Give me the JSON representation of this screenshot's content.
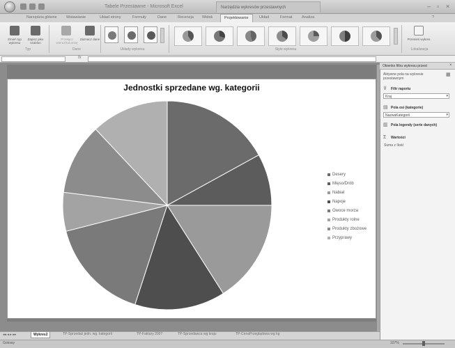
{
  "window": {
    "title": "Tabele Przestawne - Microsoft Excel",
    "context_tab_group": "Narzędzia wykresów przestawnych"
  },
  "ribbon": {
    "tabs": [
      {
        "label": "Narzędzia główne"
      },
      {
        "label": "Wstawianie"
      },
      {
        "label": "Układ strony"
      },
      {
        "label": "Formuły"
      },
      {
        "label": "Dane"
      },
      {
        "label": "Recenzja"
      },
      {
        "label": "Widok"
      },
      {
        "label": "Projektowanie",
        "active": true
      },
      {
        "label": "Układ"
      },
      {
        "label": "Format"
      },
      {
        "label": "Analiza"
      }
    ],
    "groups": {
      "type": {
        "label": "Typ",
        "buttons": [
          "Zmień typ wykresu",
          "Zapisz jako szablon"
        ]
      },
      "data": {
        "label": "Dane",
        "buttons": [
          "Przełącz wiersz/kolumnę",
          "Zaznacz dane"
        ]
      },
      "layouts": {
        "label": "Układy wykresu"
      },
      "styles": {
        "label": "Style wykresu"
      },
      "location": {
        "label": "Lokalizacja",
        "buttons": [
          "Przenieś wykres"
        ]
      }
    }
  },
  "chart_data": {
    "type": "pie",
    "title": "Jednostki sprzedane wg. kategorii",
    "categories": [
      "Desery",
      "Mięso/Drób",
      "Nabiał",
      "Napoje",
      "Owoce morza",
      "Produkty rolne",
      "Produkty zbożowe",
      "Przyprawy"
    ],
    "values": [
      17,
      8,
      16,
      14,
      16,
      6,
      11,
      12
    ],
    "colors": [
      "#6b6b6b",
      "#5c5c5c",
      "#9a9a9a",
      "#4e4e4e",
      "#7a7a7a",
      "#a3a3a3",
      "#8c8c8c",
      "#b0b0b0"
    ],
    "legend": "right"
  },
  "sheets": {
    "tabs": [
      {
        "label": "Wykres2",
        "active": true
      },
      {
        "label": "TP-Sprzedaż jedn. wg. kategorii"
      },
      {
        "label": "TP-Faktury 2007"
      },
      {
        "label": "TP-Sprzedawca wg kraju"
      },
      {
        "label": "TP-CenaPrzeglądowa wg kg"
      }
    ]
  },
  "status": {
    "text": "Gotowy",
    "zoom": "107%"
  },
  "pivot_pane": {
    "title": "Okienko filtru wykresu przest",
    "close": "×",
    "active_fields_label": "Aktywne pola na wykresie przestawnym",
    "report_filter_label": "Filtr raportu",
    "report_filter_value": "Kraj",
    "axis_fields_label": "Pola osi (kategorie)",
    "axis_fields_value": "NazwaKategorii",
    "legend_fields_label": "Pola legendy (serie danych)",
    "values_label": "Wartości",
    "values_value": "Suma z Ilość"
  }
}
